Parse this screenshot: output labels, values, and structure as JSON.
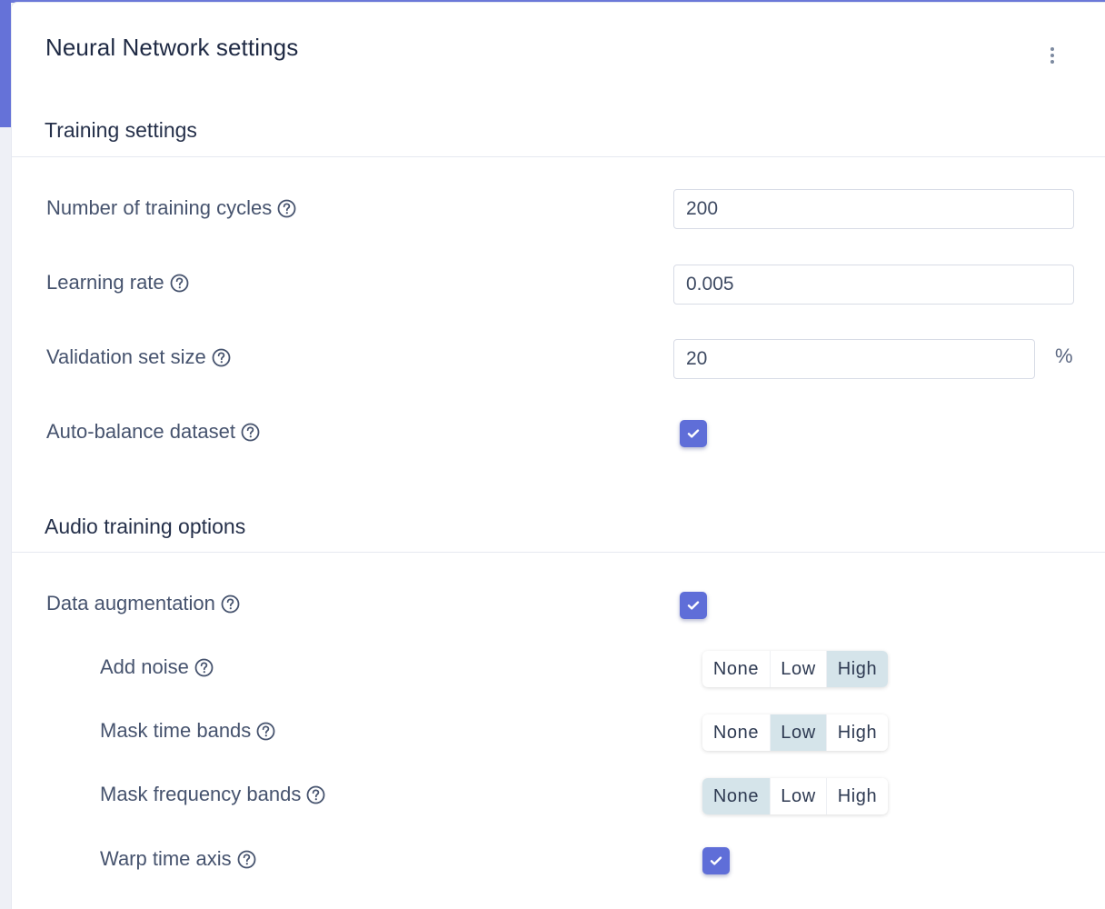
{
  "card": {
    "title": "Neural Network settings"
  },
  "training_section": {
    "title": "Training settings",
    "fields": [
      {
        "label": "Number of training cycles",
        "value": "200"
      },
      {
        "label": "Learning rate",
        "value": "0.005"
      },
      {
        "label": "Validation set size",
        "value": "20",
        "unit": "%"
      }
    ],
    "auto_balance": {
      "label": "Auto-balance dataset",
      "checked": true
    }
  },
  "audio_section": {
    "title": "Audio training options",
    "data_augmentation": {
      "label": "Data augmentation",
      "checked": true
    },
    "segmented_options": [
      "None",
      "Low",
      "High"
    ],
    "add_noise": {
      "label": "Add noise",
      "selected": "High"
    },
    "mask_time_bands": {
      "label": "Mask time bands",
      "selected": "Low"
    },
    "mask_frequency_bands": {
      "label": "Mask frequency bands",
      "selected": "None"
    },
    "warp_time_axis": {
      "label": "Warp time axis",
      "checked": true
    }
  },
  "colors": {
    "accent": "#5f6ed8",
    "selected_segment": "#d5e4ea"
  }
}
